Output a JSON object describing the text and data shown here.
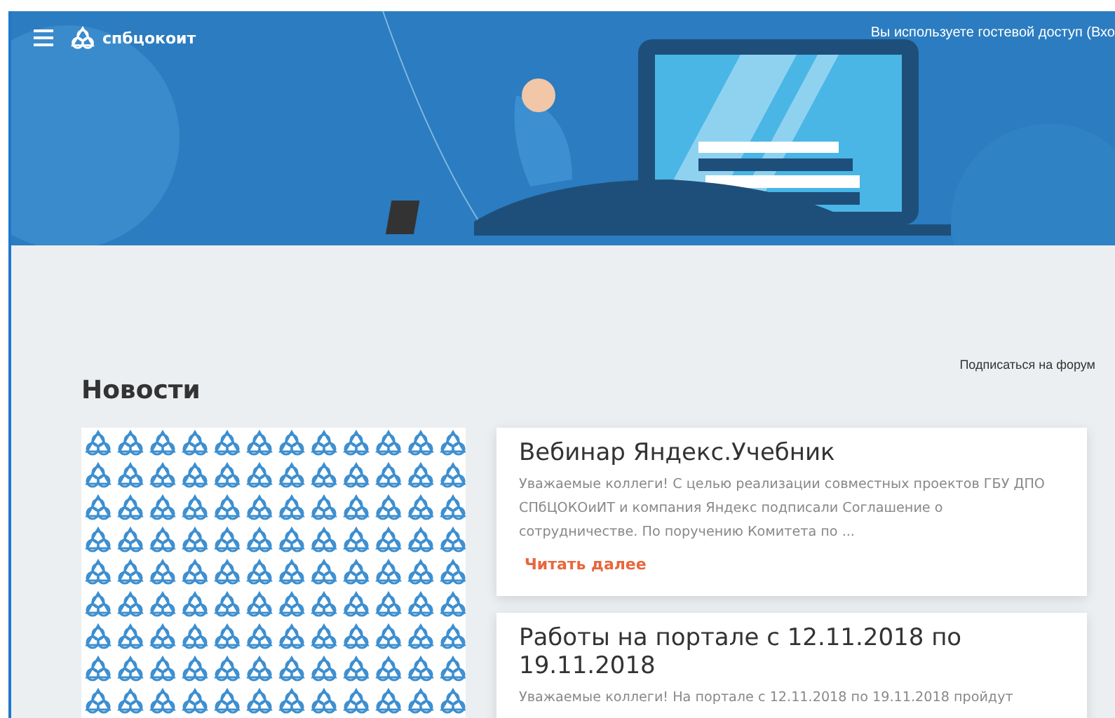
{
  "header": {
    "brand": "спбцокоит",
    "guest_notice": "Вы используете гостевой доступ (Вхо"
  },
  "forum_link": "Подписаться на форум",
  "news": {
    "title": "Новости",
    "items": [
      {
        "title": "Вебинар Яндекс.Учебник",
        "text": "Уважаемые коллеги! С целью реализации совместных проектов ГБУ ДПО СПбЦОКОиИТ и компания Яндекс подписали Соглашение о сотрудничестве. По поручению Комитета по ...",
        "more": "Читать далее"
      },
      {
        "title": "Работы на портале с 12.11.2018 по 19.11.2018",
        "text": "Уважаемые коллеги! На портале с 12.11.2018 по  19.11.2018 пройдут"
      }
    ]
  }
}
